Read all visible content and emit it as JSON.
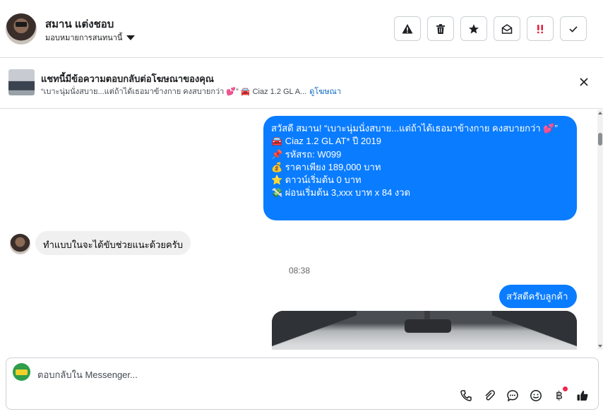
{
  "header": {
    "name": "สมาน แต่งชอบ",
    "assign_label": "มอบหมายการสนทนานี้",
    "action_icons": [
      "warning-icon",
      "trash-icon",
      "star-icon",
      "mark-unread-icon",
      "priority-icon",
      "check-icon"
    ],
    "priority_color": "#e41e3f"
  },
  "ad_context": {
    "title": "แชทนี้มีข้อความตอบกลับต่อโฆษณาของคุณ",
    "snippet": "“เบาะนุ่มนั่งสบาย...แต่ถ้าได้เธอมาข้างกาย คงสบายกว่า 💕” 🚘 Ciaz 1.2 GL A...",
    "link_label": "ดูโฆษณา"
  },
  "messages": {
    "outgoing_1": {
      "lines": [
        "สวัสดี สมาน! “เบาะนุ่มนั่งสบาย...แต่ถ้าได้เธอมาข้างกาย คงสบายกว่า 💕”",
        "🚘 Ciaz 1.2 GL AT* ปี 2019",
        " ",
        "📌 รหัสรถ: W099",
        "💰 ราคาเพียง 189,000 บาท",
        "⭐ ดาวน์เริ่มต้น 0 บาท",
        "💸 ผ่อนเริ่มต้น 3,xxx บาท x 84 งวด"
      ]
    },
    "incoming_1": {
      "text": "ทำแบบในจะได้ขับช่วยแนะด้วยครับ"
    },
    "timestamp": "08:38",
    "outgoing_2": {
      "text": "สวัสดีครับลูกค้า"
    }
  },
  "composer": {
    "placeholder": "ตอบกลับใน Messenger...",
    "tool_icons": [
      "phone-icon",
      "paperclip-icon",
      "chat-bubble-icon",
      "emoji-icon",
      "baht-icon",
      "thumbs-up-icon"
    ],
    "baht_symbol": "฿"
  },
  "colors": {
    "accent": "#0a7cff",
    "link": "#0a66c2",
    "incoming_bubble": "#f0f0f0"
  }
}
